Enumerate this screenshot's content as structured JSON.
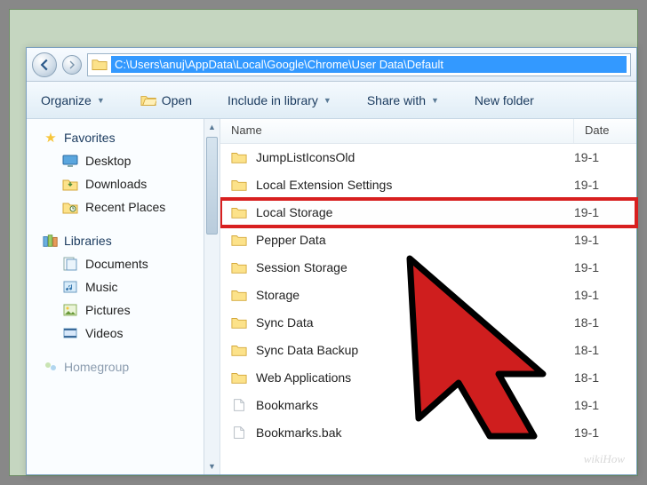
{
  "address_path": "C:\\Users\\anuj\\AppData\\Local\\Google\\Chrome\\User Data\\Default",
  "toolbar": {
    "organize": "Organize",
    "open": "Open",
    "include": "Include in library",
    "share": "Share with",
    "newfolder": "New folder"
  },
  "sidebar": {
    "favorites": "Favorites",
    "desktop": "Desktop",
    "downloads": "Downloads",
    "recent": "Recent Places",
    "libraries": "Libraries",
    "documents": "Documents",
    "music": "Music",
    "pictures": "Pictures",
    "videos": "Videos",
    "homegroup": "Homegroup"
  },
  "columns": {
    "name": "Name",
    "date": "Date"
  },
  "files": [
    {
      "name": "JumpListIconsOld",
      "type": "folder",
      "date": "19-1"
    },
    {
      "name": "Local Extension Settings",
      "type": "folder",
      "date": "19-1"
    },
    {
      "name": "Local Storage",
      "type": "folder",
      "date": "19-1",
      "highlighted": true
    },
    {
      "name": "Pepper Data",
      "type": "folder",
      "date": "19-1"
    },
    {
      "name": "Session Storage",
      "type": "folder",
      "date": "19-1"
    },
    {
      "name": "Storage",
      "type": "folder",
      "date": "19-1"
    },
    {
      "name": "Sync Data",
      "type": "folder",
      "date": "18-1"
    },
    {
      "name": "Sync Data Backup",
      "type": "folder",
      "date": "18-1"
    },
    {
      "name": "Web Applications",
      "type": "folder",
      "date": "18-1"
    },
    {
      "name": "Bookmarks",
      "type": "file",
      "date": "19-1"
    },
    {
      "name": "Bookmarks.bak",
      "type": "file",
      "date": "19-1"
    }
  ],
  "watermark": "wikiHow"
}
